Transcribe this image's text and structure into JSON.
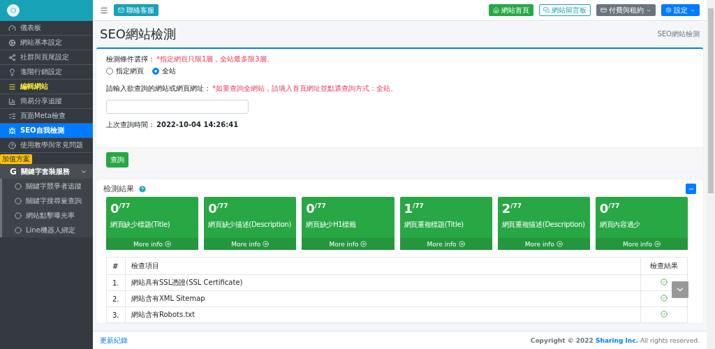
{
  "topbar": {
    "contact_button": "聯絡客服",
    "buttons": [
      {
        "label": "網站首頁",
        "kind": "home"
      },
      {
        "label": "網站留言板",
        "kind": "board"
      },
      {
        "label": "付費與租約",
        "kind": "billing"
      },
      {
        "label": "設定",
        "kind": "settings"
      }
    ]
  },
  "sidebar": {
    "items": [
      {
        "label": "儀表板",
        "selected": false,
        "highlighted": false
      },
      {
        "label": "網站基本設定",
        "selected": false,
        "highlighted": false
      },
      {
        "label": "社群與頁尾設定",
        "selected": false,
        "highlighted": false
      },
      {
        "label": "進階行銷設定",
        "selected": false,
        "highlighted": false
      },
      {
        "label": "編輯網站",
        "selected": false,
        "highlighted": true
      },
      {
        "label": "簡易分享追蹤",
        "selected": false,
        "highlighted": false
      },
      {
        "label": "頁面Meta檢查",
        "selected": false,
        "highlighted": false
      },
      {
        "label": "SEO自我檢測",
        "selected": true,
        "highlighted": false
      },
      {
        "label": "使用教學與常見問題",
        "selected": false,
        "highlighted": false
      }
    ],
    "section_badge": "加值方案",
    "group": {
      "icon_letter": "G",
      "label": "關鍵字套裝服務",
      "expanded": true,
      "children": [
        {
          "label": "關鍵字競爭者追蹤"
        },
        {
          "label": "關鍵字搜尋量查詢"
        },
        {
          "label": "網站點擊曝光率"
        },
        {
          "label": "Line機器人綁定"
        }
      ]
    }
  },
  "page": {
    "title": "SEO網站檢測",
    "breadcrumb": "SEO網站檢測"
  },
  "form": {
    "condition_label": "檢測條件選擇：",
    "condition_hint": "*指定網頁只限1層，全站最多限3層。",
    "options": [
      {
        "label": "指定網頁",
        "selected": false
      },
      {
        "label": "全站",
        "selected": true
      }
    ],
    "url_label": "請輸入欲查詢的網站或網頁網址：",
    "url_hint": "*如要查詢全網站，請填入首頁網址並點選查詢方式：全站。",
    "last_query_label": "上次查詢時間：",
    "last_query_time": "2022-10-04 14:26:41",
    "submit": "查詢"
  },
  "results": {
    "title": "檢測結果",
    "stats": [
      {
        "value": "0",
        "total": "/77",
        "label": "網頁缺少標題(Title)",
        "link": "More info"
      },
      {
        "value": "0",
        "total": "/77",
        "label": "網頁缺少描述(Description)",
        "link": "More info"
      },
      {
        "value": "0",
        "total": "/77",
        "label": "網頁缺少H1標籤",
        "link": "More info"
      },
      {
        "value": "1",
        "total": "/77",
        "label": "網頁重複標題(Title)",
        "link": "More info"
      },
      {
        "value": "2",
        "total": "/77",
        "label": "網頁重複描述(Description)",
        "link": "More info"
      },
      {
        "value": "0",
        "total": "/77",
        "label": "網頁內容過少",
        "link": "More info"
      }
    ],
    "table": {
      "columns": [
        "#",
        "檢查項目",
        "檢查結果"
      ],
      "rows": [
        {
          "number": "1.",
          "item": "網站具有SSL憑證(SSL Certificate)",
          "passed": true
        },
        {
          "number": "2.",
          "item": "網站含有XML Sitemap",
          "passed": true
        },
        {
          "number": "3.",
          "item": "網站含有Robots.txt",
          "passed": true
        }
      ]
    }
  },
  "footer": {
    "link": "更新紀錄",
    "copyright": "Copyright © 2022 ",
    "company": "Sharing Inc.",
    "rights": " All rights reserved."
  }
}
